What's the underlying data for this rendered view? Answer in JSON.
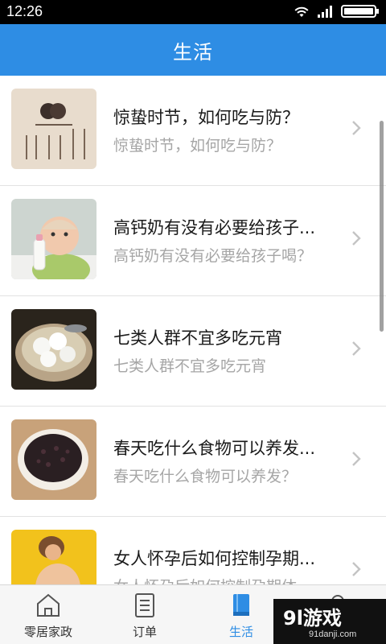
{
  "status_bar": {
    "time": "12:26"
  },
  "header": {
    "title": "生活"
  },
  "articles": [
    {
      "title": "惊蛰时节，如何吃与防？",
      "subtitle": "惊蛰时节，如何吃与防？",
      "thumb": "jingzhe-poster-image"
    },
    {
      "title": "高钙奶有没有必要给孩子...",
      "subtitle": "高钙奶有没有必要给孩子喝？",
      "thumb": "baby-with-milk-bottle-image"
    },
    {
      "title": "七类人群不宜多吃元宵",
      "subtitle": "七类人群不宜多吃元宵",
      "thumb": "tangyuan-bowl-image"
    },
    {
      "title": "春天吃什么食物可以养发...",
      "subtitle": "春天吃什么食物可以养发？",
      "thumb": "black-rice-bowl-image"
    },
    {
      "title": "女人怀孕后如何控制孕期...",
      "subtitle": "女人怀孕后如何控制孕期体",
      "thumb": "pregnant-woman-image"
    }
  ],
  "bottom_nav": {
    "items": [
      {
        "label": "零居家政",
        "icon": "home-icon"
      },
      {
        "label": "订单",
        "icon": "order-list-icon"
      },
      {
        "label": "生活",
        "icon": "book-icon",
        "active": true
      },
      {
        "label": "",
        "icon": "profile-icon"
      }
    ]
  },
  "watermark": {
    "main": "9l游戏",
    "sub": "91danji.com"
  },
  "colors": {
    "primary": "#2e8de4",
    "title_text": "#1a1a1a",
    "subtitle_text": "#a6a6a6"
  }
}
